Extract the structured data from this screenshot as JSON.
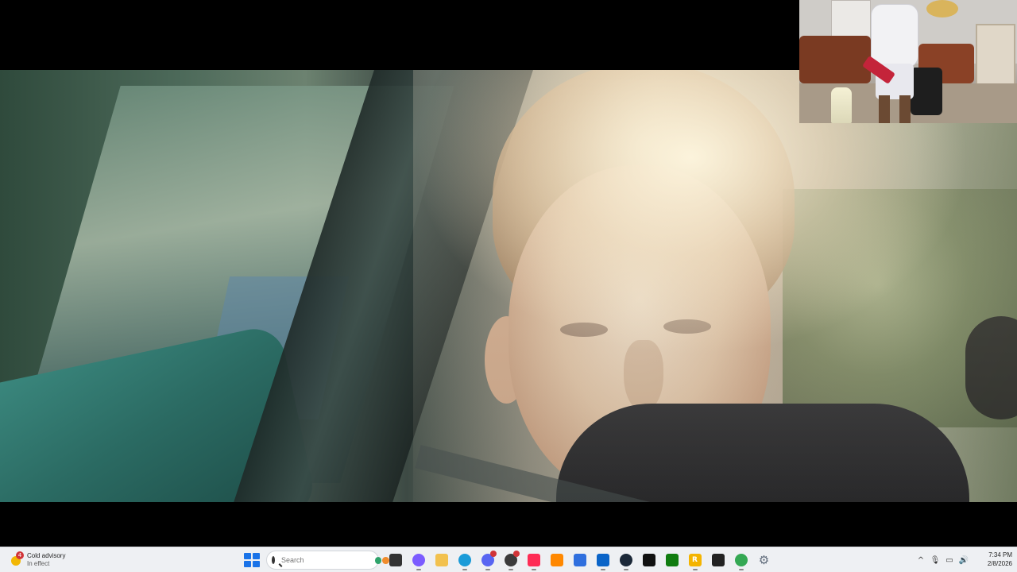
{
  "weather": {
    "title": "Cold advisory",
    "status": "In effect",
    "alert_count": "4",
    "icon": "weather-alert-icon"
  },
  "search": {
    "placeholder": "Search"
  },
  "taskbar_apps": [
    {
      "name": "file-explorer-icon",
      "glyph": "",
      "color": "#333333"
    },
    {
      "name": "copilot-icon",
      "glyph": "",
      "color": "#7b5cff"
    },
    {
      "name": "folder-icon",
      "glyph": "",
      "color": "#f2c14e"
    },
    {
      "name": "edge-icon",
      "glyph": "",
      "color": "#1a9bd8"
    },
    {
      "name": "discord-icon",
      "glyph": "",
      "color": "#5865f2"
    },
    {
      "name": "obs-icon",
      "glyph": "",
      "color": "#3b3b3b"
    },
    {
      "name": "tiktok-live-icon",
      "glyph": "",
      "color": "#fe2c55"
    },
    {
      "name": "vlc-icon",
      "glyph": "",
      "color": "#ff8800"
    },
    {
      "name": "store-icon",
      "glyph": "",
      "color": "#2f6fde"
    },
    {
      "name": "outlook-icon",
      "glyph": "",
      "color": "#0a64c8"
    },
    {
      "name": "steam-icon",
      "glyph": "",
      "color": "#1b2838"
    },
    {
      "name": "tiktok-icon",
      "glyph": "",
      "color": "#111111"
    },
    {
      "name": "xbox-icon",
      "glyph": "",
      "color": "#107c10"
    },
    {
      "name": "rockstar-icon",
      "glyph": "R",
      "color": "#f4b400"
    },
    {
      "name": "streamlabs-icon",
      "glyph": "",
      "color": "#222222"
    },
    {
      "name": "chrome-icon",
      "glyph": "",
      "color": "#34a853"
    },
    {
      "name": "settings-icon",
      "glyph": "⚙",
      "color": "#5f6b7a"
    }
  ],
  "tray": {
    "chevron": "^",
    "microphone": "🎙",
    "network": "▭",
    "volume": "🔊"
  },
  "clock": {
    "time": "7:34 PM",
    "date": "2/8/2026"
  }
}
